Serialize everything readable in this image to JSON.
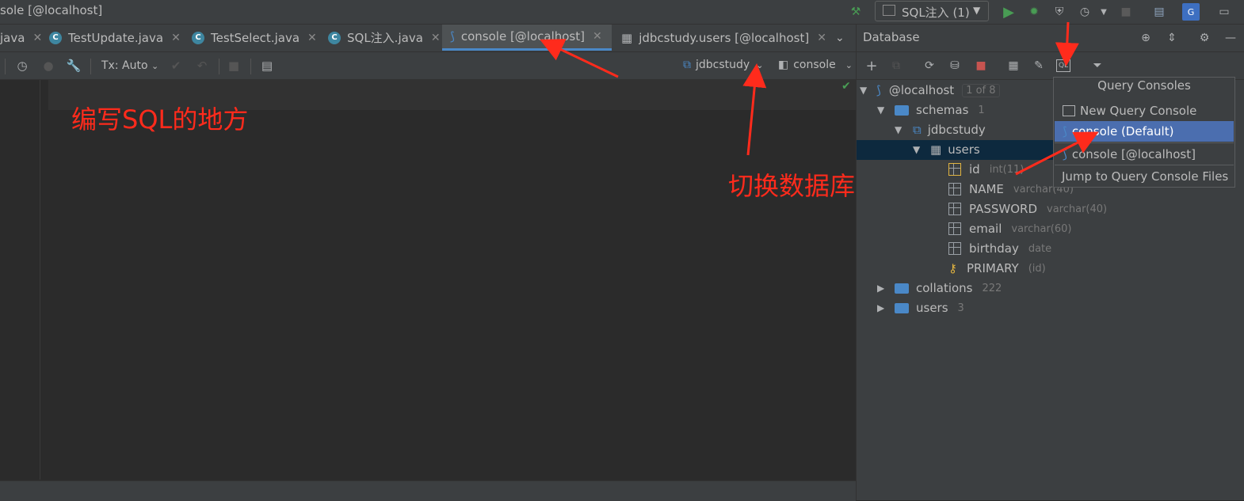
{
  "window": {
    "title": "sole [@localhost]"
  },
  "run_config": {
    "label": "SQL注入 (1)"
  },
  "editor_tabs": [
    {
      "label": "java"
    },
    {
      "label": "TestUpdate.java"
    },
    {
      "label": "TestSelect.java"
    },
    {
      "label": "SQL注入.java"
    },
    {
      "label": "console [@localhost]",
      "active": true
    },
    {
      "label": "jdbcstudy.users [@localhost]"
    }
  ],
  "editor_toolbar": {
    "tx_mode": "Tx: Auto",
    "schema_selector": "jdbcstudy",
    "session_selector": "console"
  },
  "database_panel": {
    "title": "Database",
    "tree": {
      "root": {
        "label": "@localhost",
        "badge": "1 of 8"
      },
      "schemas": {
        "label": "schemas",
        "count": "1"
      },
      "schema": {
        "label": "jdbcstudy"
      },
      "table": {
        "label": "users"
      },
      "columns": [
        {
          "name": "id",
          "type": "int(11)"
        },
        {
          "name": "NAME",
          "type": "varchar(40)"
        },
        {
          "name": "PASSWORD",
          "type": "varchar(40)"
        },
        {
          "name": "email",
          "type": "varchar(60)"
        },
        {
          "name": "birthday",
          "type": "date"
        }
      ],
      "primary_key": {
        "name": "PRIMARY",
        "meta": "(id)"
      },
      "collations": {
        "label": "collations",
        "count": "222"
      },
      "users": {
        "label": "users",
        "count": "3"
      }
    },
    "popup": {
      "title": "Query Consoles",
      "items": [
        "New Query Console",
        "console (Default)",
        "console [@localhost]",
        "Jump to Query Console Files"
      ]
    }
  },
  "annotations": {
    "write_sql": "编写SQL的地方",
    "switch_db": "切换数据库"
  },
  "colors": {
    "accent": "#4a88c7",
    "selection": "#4b6eaf",
    "annotation": "#ff2b1c",
    "run": "#499c54"
  }
}
